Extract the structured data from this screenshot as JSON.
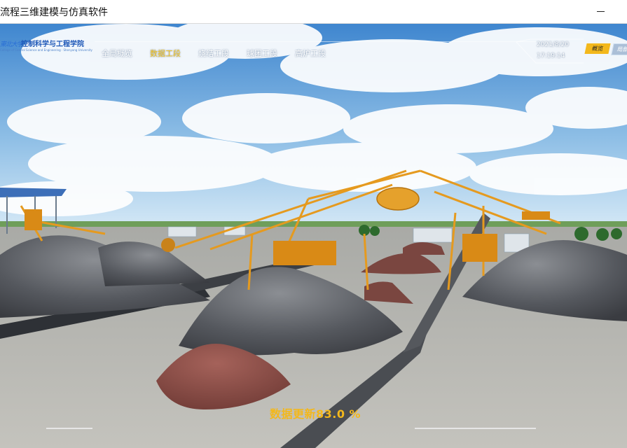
{
  "window": {
    "title": "流程三维建模与仿真软件"
  },
  "logo": {
    "university_mark": "東北大学",
    "school_name": "控制科学与工程学院",
    "english_name": "College of Control Science and Engineering · Shenyang University"
  },
  "nav": {
    "tabs": [
      {
        "label": "全局概览",
        "active": false
      },
      {
        "label": "数据工段",
        "active": true
      },
      {
        "label": "烧结工段",
        "active": false
      },
      {
        "label": "球团工段",
        "active": false
      },
      {
        "label": "高炉工段",
        "active": false
      }
    ]
  },
  "clock": {
    "date": "2021/8/20",
    "time": "17:19:14"
  },
  "view_buttons": {
    "overview": "概览",
    "other": "局部"
  },
  "status": {
    "text": "数据更新83.0 %",
    "progress_percent": 83.0
  },
  "colors": {
    "accent": "#f3b81c",
    "sky": "#5b9bd5",
    "ground": "#b9b8b2",
    "machine": "#e59a1f",
    "ore_red": "#8a4b45",
    "coal": "#5d6066"
  },
  "icons": {
    "minimize": "minimize-icon"
  }
}
